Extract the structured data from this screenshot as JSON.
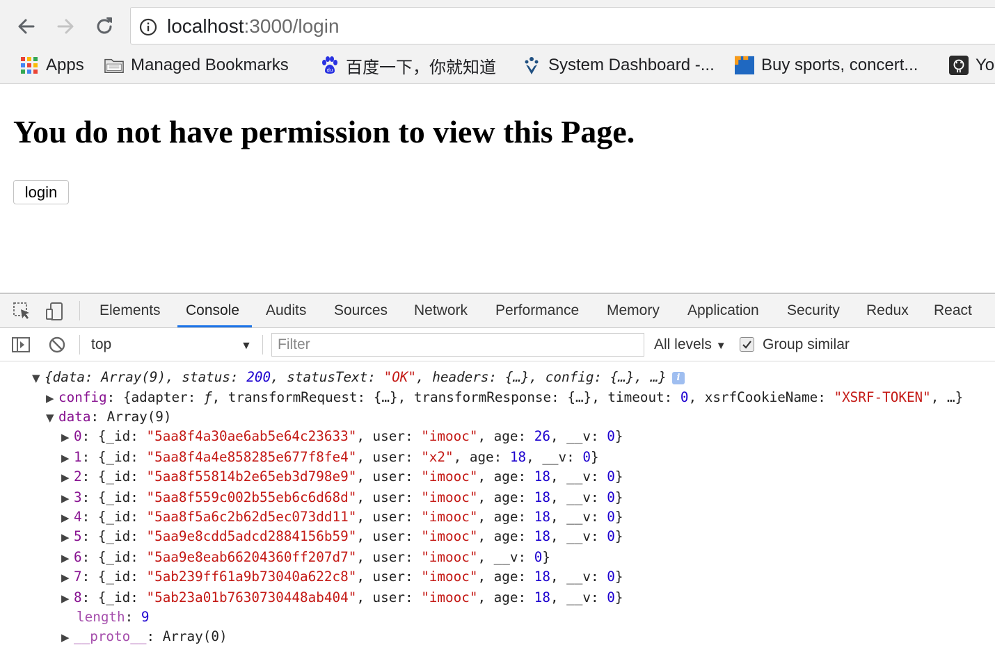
{
  "browser": {
    "url_host": "localhost",
    "url_path": ":3000/login",
    "bookmarks": [
      {
        "label": "Apps",
        "icon": "apps-grid-icon"
      },
      {
        "label": "Managed Bookmarks",
        "icon": "folder-icon"
      },
      {
        "label": "百度一下，你就知道",
        "icon": "baidu-paw-icon"
      },
      {
        "label": "System Dashboard -...",
        "icon": "jira-icon"
      },
      {
        "label": "Buy sports, concert...",
        "icon": "ticket-site-icon"
      },
      {
        "label": "Yo",
        "icon": "github-icon"
      }
    ]
  },
  "page": {
    "heading": "You do not have permission to view this Page.",
    "login_button": "login"
  },
  "devtools": {
    "tabs": [
      "Elements",
      "Console",
      "Audits",
      "Sources",
      "Network",
      "Performance",
      "Memory",
      "Application",
      "Security",
      "Redux",
      "React"
    ],
    "active_tab": "Console",
    "context": "top",
    "filter_placeholder": "Filter",
    "levels": "All levels",
    "group_similar_label": "Group similar",
    "group_similar_checked": true,
    "accent_color": "#1a73e8"
  },
  "console": {
    "summary": {
      "open": "{",
      "data_key": "data",
      "data_val": "Array(9)",
      "status_key": "status",
      "status_val": "200",
      "status_text_key": "statusText",
      "status_text_val": "\"OK\"",
      "headers_key": "headers",
      "headers_val": "{…}",
      "config_key": "config",
      "config_val": "{…}",
      "tail": ", …}"
    },
    "config_line": {
      "key": "config",
      "adapter_key": "adapter",
      "adapter_val": "ƒ",
      "transform_request_key": "transformRequest",
      "transform_request_val": "{…}",
      "transform_response_key": "transformResponse",
      "transform_response_val": "{…}",
      "timeout_key": "timeout",
      "timeout_val": "0",
      "xsrf_key": "xsrfCookieName",
      "xsrf_val": "\"XSRF-TOKEN\"",
      "tail": ", …}"
    },
    "data_line": {
      "key": "data",
      "val": "Array(9)"
    },
    "rows": [
      {
        "index": "0",
        "id": "\"5aa8f4a30ae6ab5e64c23633\"",
        "user": "\"imooc\"",
        "age": "26",
        "v": "0"
      },
      {
        "index": "1",
        "id": "\"5aa8f4a4e858285e677f8fe4\"",
        "user": "\"x2\"",
        "age": "18",
        "v": "0"
      },
      {
        "index": "2",
        "id": "\"5aa8f55814b2e65eb3d798e9\"",
        "user": "\"imooc\"",
        "age": "18",
        "v": "0"
      },
      {
        "index": "3",
        "id": "\"5aa8f559c002b55eb6c6d68d\"",
        "user": "\"imooc\"",
        "age": "18",
        "v": "0"
      },
      {
        "index": "4",
        "id": "\"5aa8f5a6c2b62d5ec073dd11\"",
        "user": "\"imooc\"",
        "age": "18",
        "v": "0"
      },
      {
        "index": "5",
        "id": "\"5aa9e8cdd5adcd2884156b59\"",
        "user": "\"imooc\"",
        "age": "18",
        "v": "0"
      },
      {
        "index": "6",
        "id": "\"5aa9e8eab66204360ff207d7\"",
        "user": "\"imooc\"",
        "age": null,
        "v": "0"
      },
      {
        "index": "7",
        "id": "\"5ab239ff61a9b73040a622c8\"",
        "user": "\"imooc\"",
        "age": "18",
        "v": "0"
      },
      {
        "index": "8",
        "id": "\"5ab23a01b7630730448ab404\"",
        "user": "\"imooc\"",
        "age": "18",
        "v": "0"
      }
    ],
    "length_line": {
      "key": "length",
      "val": "9"
    },
    "proto_line": {
      "key": "__proto__",
      "val": "Array(0)"
    },
    "colors": {
      "key": "#881391",
      "string": "#c41a16",
      "number": "#1c00cf"
    }
  }
}
